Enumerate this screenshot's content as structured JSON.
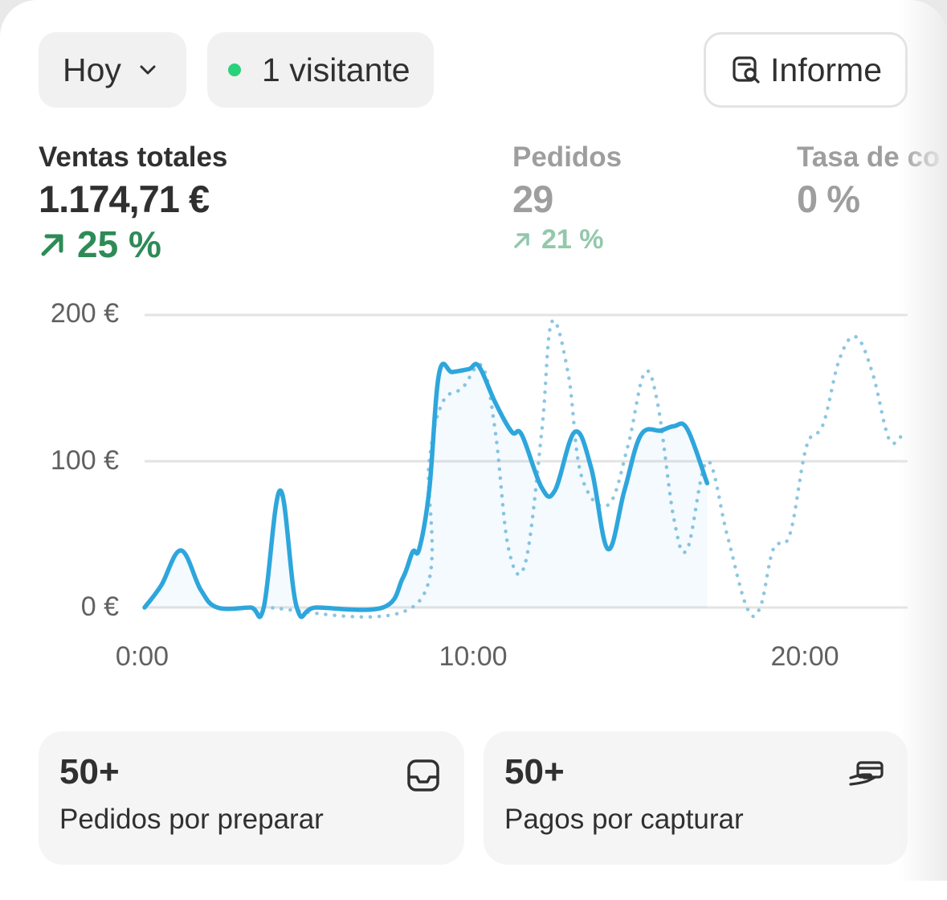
{
  "filters": {
    "date_range": "Hoy",
    "visitors": "1 visitante",
    "report_label": "Informe"
  },
  "metrics": [
    {
      "label": "Ventas totales",
      "value": "1.174,71 €",
      "delta": "25 %",
      "trend": "up"
    },
    {
      "label": "Pedidos",
      "value": "29",
      "delta": "21 %",
      "trend": "up"
    },
    {
      "label": "Tasa de co",
      "value": "0 %"
    }
  ],
  "chart_data": {
    "type": "line",
    "y_ticks": [
      "200 €",
      "100 €",
      "0 €"
    ],
    "x_ticks": [
      "0:00",
      "10:00",
      "20:00"
    ],
    "ylim": [
      0,
      200
    ],
    "xlim": [
      0,
      23
    ],
    "grid": true,
    "series": [
      {
        "style": "solid",
        "color": "#2ea6dc",
        "x": [
          0,
          0.5,
          1.1,
          1.7,
          2.2,
          3.2,
          3.6,
          4.1,
          4.6,
          5.2,
          7.2,
          7.8,
          8.1,
          8.3,
          8.6,
          8.9,
          9.3,
          9.8,
          10.1,
          10.6,
          11.1,
          11.4,
          12.0,
          12.4,
          13.0,
          13.5,
          14.0,
          14.5,
          15.0,
          15.6,
          16.0,
          16.4,
          17.0
        ],
        "y": [
          0,
          15,
          39,
          12,
          0,
          0,
          0,
          80,
          0,
          0,
          0,
          20,
          38,
          40,
          80,
          160,
          161,
          163,
          165,
          140,
          120,
          118,
          82,
          80,
          120,
          95,
          40,
          80,
          118,
          121,
          124,
          122,
          85
        ]
      },
      {
        "style": "dotted",
        "color": "#8cc6e2",
        "x": [
          3.6,
          8.2,
          8.6,
          9.0,
          9.6,
          10.2,
          10.6,
          11.0,
          11.5,
          12.0,
          12.3,
          12.8,
          13.2,
          14.0,
          14.6,
          15.1,
          15.5,
          16.0,
          16.4,
          17.0,
          17.6,
          18.2,
          18.6,
          19.0,
          19.5,
          20.0,
          20.5,
          21.0,
          21.5,
          22.0,
          22.5,
          22.9
        ],
        "y": [
          0,
          2,
          100,
          140,
          150,
          165,
          120,
          40,
          30,
          120,
          195,
          160,
          90,
          70,
          110,
          160,
          140,
          60,
          40,
          100,
          50,
          0,
          0,
          40,
          50,
          110,
          125,
          170,
          185,
          160,
          115,
          118
        ]
      }
    ]
  },
  "tiles": [
    {
      "count": "50+",
      "caption": "Pedidos por preparar",
      "icon": "inbox-icon"
    },
    {
      "count": "50+",
      "caption": "Pagos por capturar",
      "icon": "hand-payment-icon"
    }
  ]
}
